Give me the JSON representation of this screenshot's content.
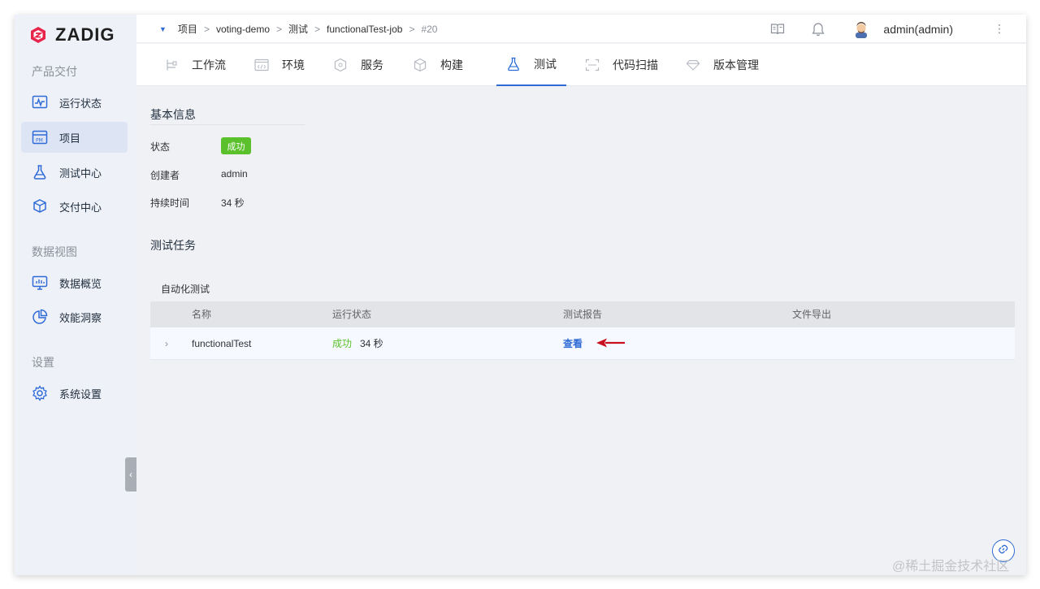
{
  "brand": {
    "name": "ZADIG",
    "logo_color": "#e8244b"
  },
  "sidebar": {
    "sections": [
      {
        "title": "产品交付"
      },
      {
        "title": "数据视图"
      },
      {
        "title": "设置"
      }
    ],
    "items": [
      {
        "label": "运行状态",
        "icon": "monitor-pulse-icon"
      },
      {
        "label": "项目",
        "icon": "pm-board-icon",
        "active": true
      },
      {
        "label": "测试中心",
        "icon": "flask-icon"
      },
      {
        "label": "交付中心",
        "icon": "package-icon"
      },
      {
        "label": "数据概览",
        "icon": "chart-monitor-icon"
      },
      {
        "label": "效能洞察",
        "icon": "pie-chart-icon"
      },
      {
        "label": "系统设置",
        "icon": "gear-icon"
      }
    ]
  },
  "breadcrumb": {
    "items": [
      "项目",
      "voting-demo",
      "测试",
      "functionalTest-job",
      "#20"
    ],
    "separator": ">"
  },
  "header": {
    "user": "admin(admin)"
  },
  "tabs": [
    {
      "label": "工作流",
      "icon": "workflow-icon"
    },
    {
      "label": "环境",
      "icon": "code-window-icon"
    },
    {
      "label": "服务",
      "icon": "cube-cluster-icon"
    },
    {
      "label": "构建",
      "icon": "cube-icon"
    },
    {
      "label": "测试",
      "icon": "flask-icon",
      "active": true
    },
    {
      "label": "代码扫描",
      "icon": "scan-icon"
    },
    {
      "label": "版本管理",
      "icon": "diamond-icon"
    }
  ],
  "basic_info": {
    "title": "基本信息",
    "status_label": "状态",
    "status_value": "成功",
    "creator_label": "创建者",
    "creator_value": "admin",
    "duration_label": "持续时间",
    "duration_value": "34 秒"
  },
  "test_tasks": {
    "title": "测试任务",
    "subtitle": "自动化测试",
    "columns": [
      "名称",
      "运行状态",
      "测试报告",
      "文件导出"
    ],
    "rows": [
      {
        "name": "functionalTest",
        "status": "成功",
        "duration": "34 秒",
        "report_link": "查看",
        "export": ""
      }
    ]
  },
  "colors": {
    "accent": "#2f6bd7",
    "success": "#5ac02b",
    "arrow": "#c8101e"
  },
  "watermark": "@稀土掘金技术社区"
}
